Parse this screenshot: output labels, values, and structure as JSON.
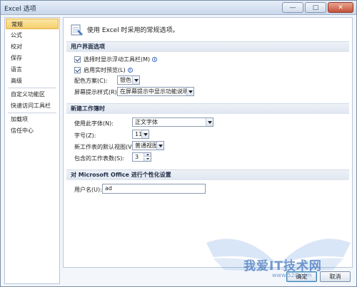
{
  "window": {
    "title": "Excel 选项",
    "buttons": {
      "minimize": "—",
      "maximize": "□",
      "close": "✕"
    }
  },
  "sidebar": {
    "items": [
      {
        "label": "常规",
        "active": true
      },
      {
        "label": "公式"
      },
      {
        "label": "校对"
      },
      {
        "label": "保存"
      },
      {
        "label": "语言"
      },
      {
        "label": "高级"
      },
      {
        "label": "自定义功能区"
      },
      {
        "label": "快速访问工具栏"
      },
      {
        "label": "加载项"
      },
      {
        "label": "信任中心"
      }
    ]
  },
  "content": {
    "intro": "使用 Excel 时采用的常规选项。",
    "ui_section": {
      "title": "用户界面选项",
      "show_mini_toolbar": "选择时显示浮动工具栏(M)",
      "live_preview": "启用实时预览(L)",
      "color_scheme_label": "配色方案(C):",
      "color_scheme_value": "银色",
      "screentip_label": "屏幕提示样式(R):",
      "screentip_value": "在屏幕提示中显示功能说明"
    },
    "new_workbook_section": {
      "title": "新建工作簿时",
      "font_label": "使用此字体(N):",
      "font_value": "正文字体",
      "font_size_label": "字号(Z):",
      "font_size_value": "11",
      "default_view_label": "新工作表的默认视图(V):",
      "default_view_value": "普通视图",
      "sheets_label": "包含的工作表数(S):",
      "sheets_value": "3"
    },
    "personalize_section": {
      "title": "对 Microsoft Office 进行个性化设置",
      "username_label": "用户名(U):",
      "username_value": "ad"
    }
  },
  "footer": {
    "ok": "确定",
    "cancel": "取消"
  },
  "watermark": {
    "text": "我爱IT技术网",
    "url": "www.52ij.com"
  },
  "colors": {
    "active_item": "#f6d06e",
    "section_header": "#dfe6f0",
    "window_frame": "#7b8ea8"
  }
}
